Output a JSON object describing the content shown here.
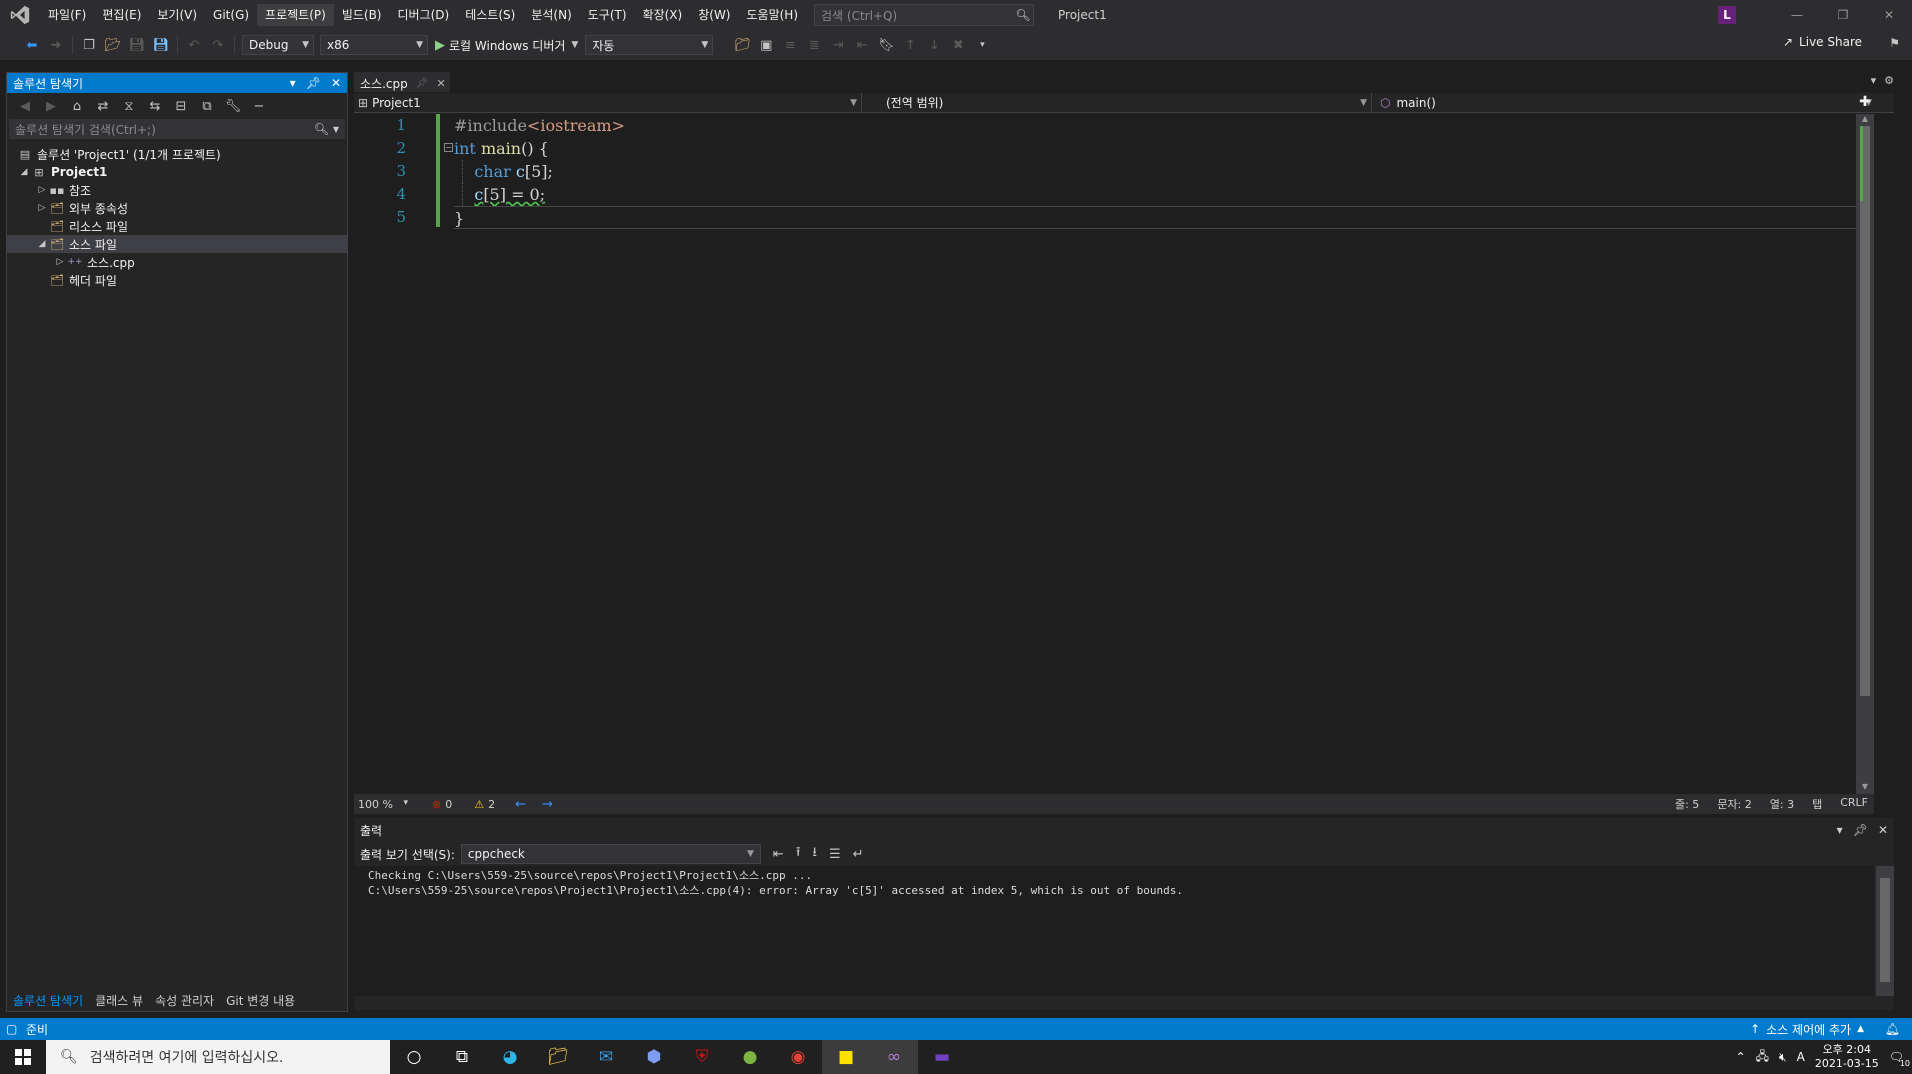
{
  "titlebar": {
    "menu": [
      "파일(F)",
      "편집(E)",
      "보기(V)",
      "Git(G)",
      "프로젝트(P)",
      "빌드(B)",
      "디버그(D)",
      "테스트(S)",
      "분석(N)",
      "도구(T)",
      "확장(X)",
      "창(W)",
      "도움말(H)"
    ],
    "search_placeholder": "검색 (Ctrl+Q)",
    "project_name": "Project1",
    "avatar_initial": "L"
  },
  "toolbar": {
    "config": "Debug",
    "platform": "x86",
    "run_label": "로컬 Windows 디버거",
    "run_mode": "자동",
    "live_share": "Live Share"
  },
  "solution_explorer": {
    "title": "솔루션 탐색기",
    "search_placeholder": "솔루션 탐색기 검색(Ctrl+;)",
    "tree": {
      "solution": "솔루션 'Project1' (1/1개 프로젝트)",
      "project": "Project1",
      "references": "참조",
      "external_deps": "외부 종속성",
      "resource_files": "리소스 파일",
      "source_files": "소스 파일",
      "source_cpp": "소스.cpp",
      "header_files": "헤더 파일"
    },
    "bottom_tabs": [
      "솔루션 탐색기",
      "클래스 뷰",
      "속성 관리자",
      "Git 변경 내용"
    ]
  },
  "editor": {
    "tab_name": "소스.cpp",
    "nav_project": "Project1",
    "nav_scope": "(전역 범위)",
    "nav_member": "main()",
    "line_numbers": [
      "1",
      "2",
      "3",
      "4",
      "5"
    ],
    "code": {
      "l1_pre": "#include",
      "l1_inc": "<iostream>",
      "l2_kw": "int",
      "l2_fn": "main",
      "l2_rest": "() {",
      "l3_kw": "char",
      "l3_var": "c",
      "l3_rest": "[5];",
      "l4_var": "c",
      "l4_rest": "[5] = 0;",
      "l5": "}"
    }
  },
  "editor_status": {
    "zoom": "100 %",
    "errors": "0",
    "warnings": "2",
    "line": "줄: 5",
    "char": "문자: 2",
    "col": "열: 3",
    "tab": "탭",
    "eol": "CRLF"
  },
  "output": {
    "title": "출력",
    "show_from_label": "출력 보기 선택(S):",
    "source": "cppcheck",
    "lines": [
      "Checking C:\\Users\\559-25\\source\\repos\\Project1\\Project1\\소스.cpp ...",
      "C:\\Users\\559-25\\source\\repos\\Project1\\Project1\\소스.cpp(4): error: Array 'c[5]' accessed at index 5, which is out of bounds."
    ]
  },
  "statusbar": {
    "ready": "준비",
    "source_control": "소스 제어에 추가"
  },
  "taskbar": {
    "search_placeholder": "검색하려면 여기에 입력하십시오.",
    "time": "오후 2:04",
    "date": "2021-03-15",
    "ime": "A",
    "notif_count": "10"
  },
  "colors": {
    "accent": "#007acc",
    "keyword": "#569cd6",
    "include": "#d69d85",
    "function": "#dcdcaa",
    "variable": "#9cdcfe"
  }
}
